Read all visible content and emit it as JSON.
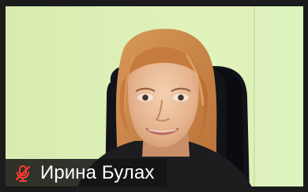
{
  "participant": {
    "name": "Ирина Булах",
    "mic_icon": "mic-muted-icon",
    "muted": true
  },
  "colors": {
    "background_wall": "#d8efb2",
    "frame_dark": "#1b1b1b",
    "mute_red": "#ff3b30",
    "name_plate_bg": "#141414"
  }
}
